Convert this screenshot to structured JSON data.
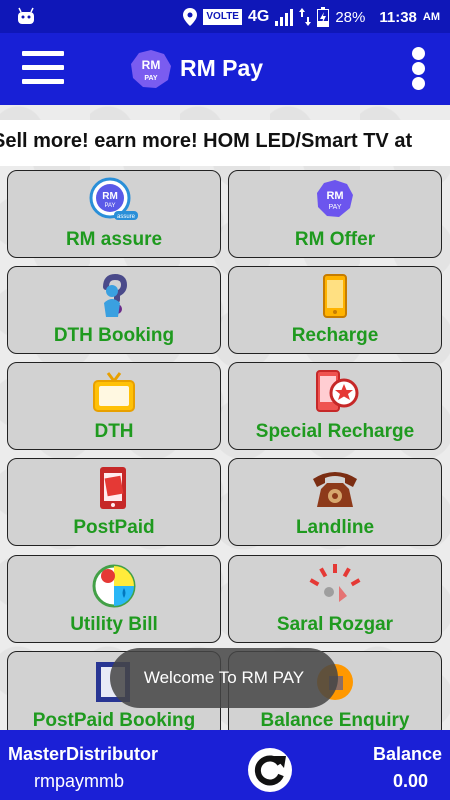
{
  "status_bar": {
    "network_badge": "VOLTE",
    "network_type": "4G",
    "battery": "28%",
    "time": "11:38",
    "ampm": "AM"
  },
  "app_bar": {
    "logo_text_top": "RM",
    "logo_text_bottom": "PAY",
    "title": "RM Pay"
  },
  "ticker": {
    "text": "Sell more! earn more! HOM LED/Smart TV at"
  },
  "tiles": [
    {
      "label": "RM assure",
      "icon": "rm-assure-icon"
    },
    {
      "label": "RM Offer",
      "icon": "rm-pay-icon"
    },
    {
      "label": "DTH Booking",
      "icon": "person-question-icon"
    },
    {
      "label": "Recharge",
      "icon": "phone-icon"
    },
    {
      "label": "DTH",
      "icon": "tv-icon"
    },
    {
      "label": "Special Recharge",
      "icon": "phone-star-icon"
    },
    {
      "label": "PostPaid",
      "icon": "phone-bill-icon"
    },
    {
      "label": "Landline",
      "icon": "telephone-icon"
    },
    {
      "label": "Utility Bill",
      "icon": "utility-icon"
    },
    {
      "label": "Saral Rozgar",
      "icon": "saral-rozgar-icon"
    },
    {
      "label": "PostPaid Booking",
      "icon": "postpaid-booking-icon"
    },
    {
      "label": "Balance Enquiry",
      "icon": "balance-enquiry-icon"
    }
  ],
  "icon_text": {
    "rm": "RM",
    "pay": "PAY",
    "assure": "assure"
  },
  "toast": {
    "message": "Welcome To RM PAY"
  },
  "footer": {
    "role": "MasterDistributor",
    "username": "rmpaymmb",
    "balance_label": "Balance",
    "balance_value": "0.00"
  },
  "colors": {
    "primary": "#1820d6",
    "status_bar": "#0f17b8",
    "tile_label": "#1f9a1f",
    "tile_bg": "#d2d2d2"
  }
}
